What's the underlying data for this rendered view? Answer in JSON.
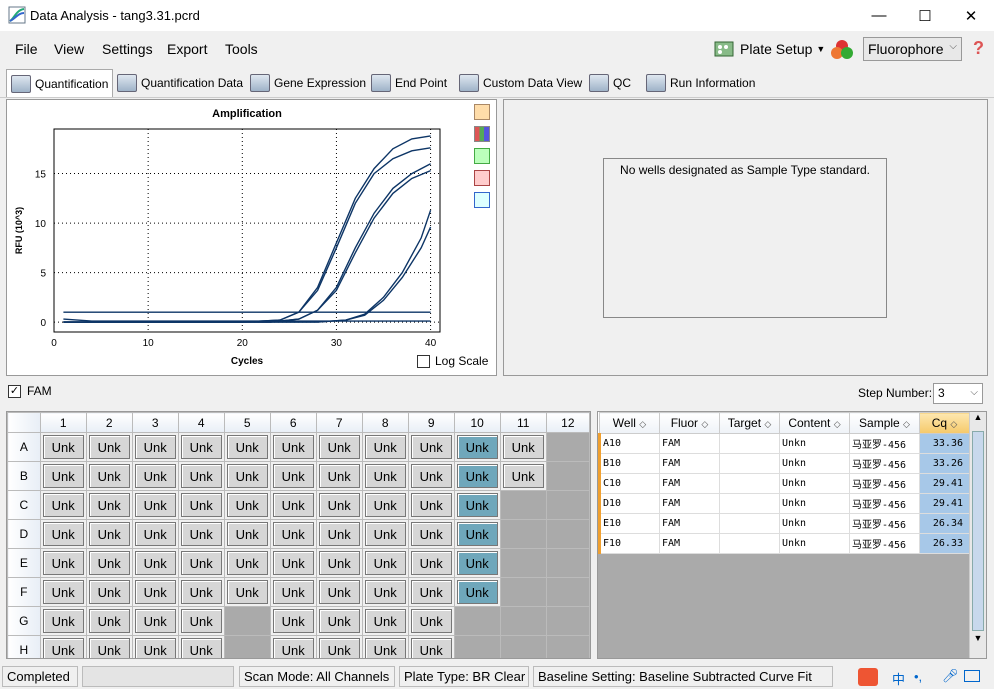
{
  "window": {
    "title": "Data Analysis - tang3.31.pcrd",
    "minimize": "—",
    "maximize": "☐",
    "close": "✕"
  },
  "menu": [
    "File",
    "View",
    "Settings",
    "Export",
    "Tools"
  ],
  "toolbar": {
    "plate_setup": "Plate Setup",
    "fluorophore": "Fluorophore",
    "help": "?"
  },
  "tabs": [
    "Quantification",
    "Quantification Data",
    "Gene Expression",
    "End Point",
    "Custom Data View",
    "QC",
    "Run Information"
  ],
  "chart_data": {
    "type": "line",
    "title": "Amplification",
    "xlabel": "Cycles",
    "ylabel": "RFU (10^3)",
    "xlim": [
      0,
      41
    ],
    "ylim": [
      -1,
      19.5
    ],
    "xticks": [
      0,
      10,
      20,
      30,
      40
    ],
    "yticks": [
      0,
      5,
      10,
      15
    ],
    "grid": true,
    "log_scale_label": "Log Scale",
    "series": [
      {
        "values": [
          [
            1,
            0
          ],
          [
            20,
            0
          ],
          [
            24,
            0.2
          ],
          [
            26,
            1
          ],
          [
            28,
            3.5
          ],
          [
            30,
            8
          ],
          [
            32,
            12.5
          ],
          [
            34,
            15.5
          ],
          [
            36,
            17.5
          ],
          [
            38,
            18.5
          ],
          [
            40,
            18.8
          ]
        ]
      },
      {
        "values": [
          [
            1,
            0
          ],
          [
            20,
            0
          ],
          [
            24,
            0.2
          ],
          [
            26,
            1
          ],
          [
            28,
            3.2
          ],
          [
            30,
            7.5
          ],
          [
            32,
            12
          ],
          [
            34,
            15
          ],
          [
            36,
            16.5
          ],
          [
            38,
            17.3
          ],
          [
            40,
            17.6
          ]
        ]
      },
      {
        "values": [
          [
            1,
            0
          ],
          [
            23,
            0
          ],
          [
            26,
            0.3
          ],
          [
            28,
            1.2
          ],
          [
            30,
            3.5
          ],
          [
            32,
            7.5
          ],
          [
            34,
            11
          ],
          [
            36,
            13.5
          ],
          [
            38,
            15
          ],
          [
            40,
            16
          ]
        ]
      },
      {
        "values": [
          [
            1,
            0
          ],
          [
            23,
            0
          ],
          [
            26,
            0.3
          ],
          [
            28,
            1.2
          ],
          [
            30,
            3.2
          ],
          [
            32,
            7
          ],
          [
            34,
            10.5
          ],
          [
            36,
            13
          ],
          [
            38,
            14.5
          ],
          [
            40,
            15.3
          ]
        ]
      },
      {
        "values": [
          [
            1,
            0
          ],
          [
            28,
            0
          ],
          [
            31,
            0.2
          ],
          [
            33,
            0.8
          ],
          [
            35,
            2.5
          ],
          [
            37,
            5
          ],
          [
            39,
            8.5
          ],
          [
            40,
            11.3
          ]
        ]
      },
      {
        "values": [
          [
            1,
            0
          ],
          [
            28,
            0
          ],
          [
            31,
            0.2
          ],
          [
            33,
            0.7
          ],
          [
            35,
            2.2
          ],
          [
            37,
            4.5
          ],
          [
            39,
            7.5
          ],
          [
            40,
            9.6
          ]
        ]
      },
      {
        "values": [
          [
            1,
            0.3
          ],
          [
            4,
            0.1
          ],
          [
            10,
            0.1
          ],
          [
            40,
            0.1
          ]
        ]
      },
      {
        "values": [
          [
            1,
            1
          ],
          [
            40,
            1
          ]
        ]
      }
    ]
  },
  "std_message": "No wells designated as Sample Type standard.",
  "fam_label": "FAM",
  "step": {
    "label": "Step Number:",
    "value": "3"
  },
  "plate": {
    "cols": [
      "1",
      "2",
      "3",
      "4",
      "5",
      "6",
      "7",
      "8",
      "9",
      "10",
      "11",
      "12"
    ],
    "rows": [
      {
        "label": "A",
        "wells": [
          "Unk",
          "Unk",
          "Unk",
          "Unk",
          "Unk",
          "Unk",
          "Unk",
          "Unk",
          "Unk",
          "Unk",
          "Unk",
          ""
        ]
      },
      {
        "label": "B",
        "wells": [
          "Unk",
          "Unk",
          "Unk",
          "Unk",
          "Unk",
          "Unk",
          "Unk",
          "Unk",
          "Unk",
          "Unk",
          "Unk",
          ""
        ]
      },
      {
        "label": "C",
        "wells": [
          "Unk",
          "Unk",
          "Unk",
          "Unk",
          "Unk",
          "Unk",
          "Unk",
          "Unk",
          "Unk",
          "Unk",
          "",
          ""
        ]
      },
      {
        "label": "D",
        "wells": [
          "Unk",
          "Unk",
          "Unk",
          "Unk",
          "Unk",
          "Unk",
          "Unk",
          "Unk",
          "Unk",
          "Unk",
          "",
          ""
        ]
      },
      {
        "label": "E",
        "wells": [
          "Unk",
          "Unk",
          "Unk",
          "Unk",
          "Unk",
          "Unk",
          "Unk",
          "Unk",
          "Unk",
          "Unk",
          "",
          ""
        ]
      },
      {
        "label": "F",
        "wells": [
          "Unk",
          "Unk",
          "Unk",
          "Unk",
          "Unk",
          "Unk",
          "Unk",
          "Unk",
          "Unk",
          "Unk",
          "",
          ""
        ]
      },
      {
        "label": "G",
        "wells": [
          "Unk",
          "Unk",
          "Unk",
          "Unk",
          "",
          "Unk",
          "Unk",
          "Unk",
          "Unk",
          "",
          "",
          ""
        ]
      },
      {
        "label": "H",
        "wells": [
          "Unk",
          "Unk",
          "Unk",
          "Unk",
          "",
          "Unk",
          "Unk",
          "Unk",
          "Unk",
          "",
          "",
          ""
        ]
      }
    ],
    "selected_col": "10"
  },
  "well_table": {
    "headers": [
      "Well",
      "Fluor",
      "Target",
      "Content",
      "Sample",
      "Cq"
    ],
    "rows": [
      [
        "A10",
        "FAM",
        "",
        "Unkn",
        "马亚罗-456",
        "33.36"
      ],
      [
        "B10",
        "FAM",
        "",
        "Unkn",
        "马亚罗-456",
        "33.26"
      ],
      [
        "C10",
        "FAM",
        "",
        "Unkn",
        "马亚罗-456",
        "29.41"
      ],
      [
        "D10",
        "FAM",
        "",
        "Unkn",
        "马亚罗-456",
        "29.41"
      ],
      [
        "E10",
        "FAM",
        "",
        "Unkn",
        "马亚罗-456",
        "26.34"
      ],
      [
        "F10",
        "FAM",
        "",
        "Unkn",
        "马亚罗-456",
        "26.33"
      ]
    ]
  },
  "status": {
    "state": "Completed",
    "scan": "Scan Mode: All Channels",
    "plate_type": "Plate Type: BR Clear",
    "baseline": "Baseline Setting: Baseline Subtracted Curve Fit"
  }
}
